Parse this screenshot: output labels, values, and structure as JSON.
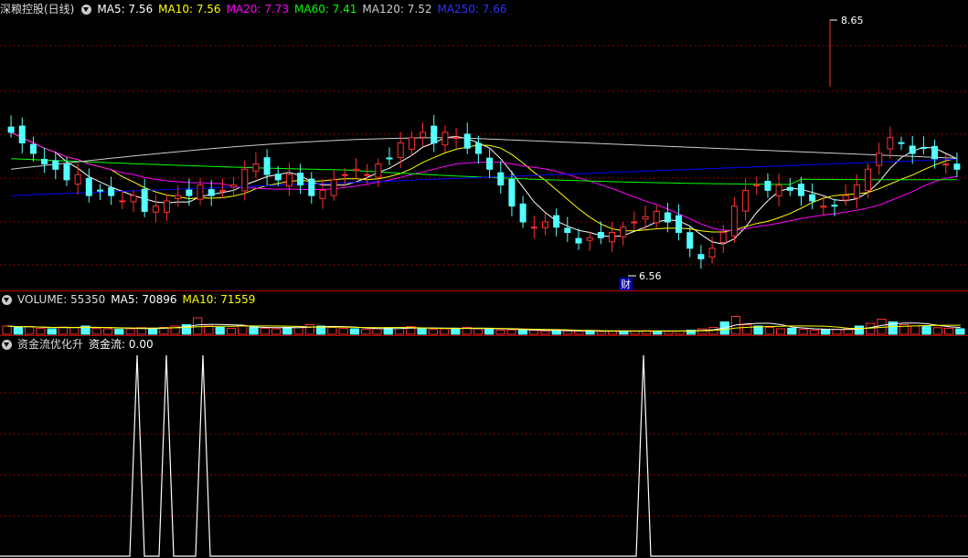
{
  "header_main": {
    "title": "深粮控股(日线)",
    "ma": [
      {
        "label": "MA5: 7.56",
        "color": "#ffffff"
      },
      {
        "label": "MA10: 7.56",
        "color": "#ffff00"
      },
      {
        "label": "MA20: 7.73",
        "color": "#ff00ff"
      },
      {
        "label": "MA60: 7.41",
        "color": "#00ff00"
      },
      {
        "label": "MA120: 7.52",
        "color": "#cccccc"
      },
      {
        "label": "MA250: 7.66",
        "color": "#0000ff"
      }
    ]
  },
  "header_volume": {
    "title": "VOLUME: 55350",
    "ma5": "MA5: 70896",
    "ma10": "MA10: 71559"
  },
  "header_indicator": {
    "title": "资金流优化升",
    "value": "资金流: 0.00"
  },
  "annotations": {
    "high": "8.65",
    "low": "6.56",
    "event": "财"
  },
  "colors": {
    "up": "#ff3030",
    "down": "#54ffff",
    "grid": "#8b0000",
    "separator": "#b00000",
    "text": "#dddddd"
  },
  "chart_data": [
    {
      "type": "candlestick",
      "name": "price",
      "ylim": [
        6.3,
        8.9
      ],
      "candles_approx": 86,
      "closes": [
        7.8,
        7.7,
        7.6,
        7.5,
        7.45,
        7.35,
        7.4,
        7.2,
        7.25,
        7.2,
        7.15,
        7.2,
        7.05,
        7.1,
        7.15,
        7.2,
        7.2,
        7.3,
        7.2,
        7.25,
        7.3,
        7.45,
        7.5,
        7.4,
        7.35,
        7.4,
        7.3,
        7.2,
        7.25,
        7.35,
        7.4,
        7.45,
        7.4,
        7.5,
        7.55,
        7.7,
        7.75,
        7.8,
        7.7,
        7.8,
        7.75,
        7.65,
        7.6,
        7.45,
        7.3,
        7.1,
        6.95,
        6.9,
        6.95,
        6.9,
        6.85,
        6.75,
        6.8,
        6.8,
        6.85,
        6.9,
        6.95,
        7.0,
        7.05,
        6.95,
        6.85,
        6.7,
        6.6,
        6.7,
        6.85,
        7.1,
        7.25,
        7.3,
        7.25,
        7.3,
        7.25,
        7.2,
        7.15,
        7.1,
        7.1,
        7.2,
        7.3,
        7.45,
        7.6,
        7.75,
        7.7,
        7.6,
        7.65,
        7.55,
        7.5,
        7.45
      ],
      "ma_series": [
        {
          "name": "MA5",
          "color": "#ffffff"
        },
        {
          "name": "MA10",
          "color": "#ffff00"
        },
        {
          "name": "MA20",
          "color": "#ff00ff"
        },
        {
          "name": "MA60",
          "color": "#00ff00"
        },
        {
          "name": "MA120",
          "color": "#cccccc"
        },
        {
          "name": "MA250",
          "color": "#0000ff"
        }
      ]
    },
    {
      "type": "bar",
      "name": "volume",
      "values_relative": [
        0.3,
        0.25,
        0.28,
        0.22,
        0.2,
        0.26,
        0.25,
        0.3,
        0.22,
        0.2,
        0.18,
        0.2,
        0.24,
        0.22,
        0.25,
        0.3,
        0.35,
        0.6,
        0.3,
        0.25,
        0.22,
        0.3,
        0.26,
        0.22,
        0.2,
        0.25,
        0.28,
        0.35,
        0.3,
        0.25,
        0.22,
        0.2,
        0.18,
        0.2,
        0.22,
        0.25,
        0.28,
        0.22,
        0.18,
        0.2,
        0.22,
        0.25,
        0.2,
        0.18,
        0.15,
        0.16,
        0.15,
        0.14,
        0.12,
        0.14,
        0.12,
        0.11,
        0.12,
        0.1,
        0.11,
        0.12,
        0.12,
        0.13,
        0.12,
        0.11,
        0.12,
        0.15,
        0.2,
        0.25,
        0.45,
        0.65,
        0.35,
        0.3,
        0.25,
        0.2,
        0.22,
        0.18,
        0.15,
        0.16,
        0.18,
        0.2,
        0.3,
        0.4,
        0.55,
        0.45,
        0.35,
        0.3,
        0.28,
        0.24,
        0.22,
        0.2
      ]
    },
    {
      "type": "line",
      "name": "资金流",
      "spike_indices": [
        20,
        24,
        30,
        96
      ],
      "ylim": [
        0,
        1
      ]
    }
  ]
}
